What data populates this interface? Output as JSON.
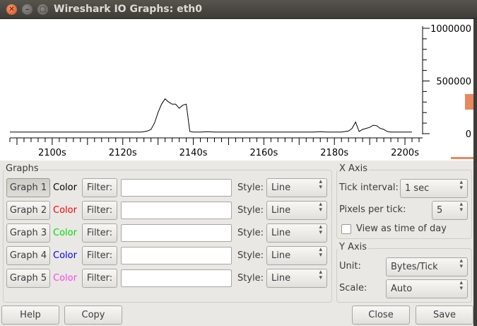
{
  "window": {
    "title": "Wireshark IO Graphs: eth0"
  },
  "chart_data": {
    "type": "line",
    "x": [
      2088,
      2090,
      2092,
      2094,
      2096,
      2098,
      2100,
      2102,
      2104,
      2106,
      2108,
      2110,
      2112,
      2114,
      2116,
      2118,
      2119,
      2120,
      2121,
      2122,
      2123,
      2124,
      2125,
      2126,
      2127,
      2128,
      2129,
      2130,
      2131,
      2132,
      2133,
      2134,
      2135,
      2136,
      2137,
      2138,
      2139,
      2140,
      2142,
      2144,
      2146,
      2148,
      2150,
      2152,
      2154,
      2156,
      2158,
      2160,
      2162,
      2164,
      2166,
      2168,
      2170,
      2172,
      2174,
      2176,
      2178,
      2180,
      2182,
      2183,
      2184,
      2185,
      2186,
      2187,
      2188,
      2189,
      2190,
      2191,
      2192,
      2193,
      2194,
      2195,
      2196,
      2198,
      2200,
      2202
    ],
    "values": [
      15000,
      15000,
      15000,
      15000,
      15000,
      15000,
      15000,
      15000,
      15000,
      15000,
      15000,
      15000,
      15000,
      15000,
      15000,
      15000,
      15000,
      15000,
      15000,
      15000,
      15000,
      15000,
      15000,
      18000,
      25000,
      40000,
      100000,
      200000,
      280000,
      330000,
      300000,
      280000,
      280000,
      240000,
      270000,
      280000,
      20000,
      15000,
      15000,
      18000,
      15000,
      15000,
      15000,
      15000,
      15000,
      15000,
      15000,
      15000,
      15000,
      15000,
      15000,
      15000,
      15000,
      15000,
      15000,
      18000,
      15000,
      15000,
      15000,
      20000,
      25000,
      50000,
      110000,
      20000,
      40000,
      50000,
      60000,
      80000,
      75000,
      50000,
      40000,
      20000,
      15000,
      15000,
      15000,
      15000
    ],
    "xticks": [
      "2100s",
      "2120s",
      "2140s",
      "2160s",
      "2180s",
      "2200s"
    ],
    "xtick_values": [
      2100,
      2120,
      2140,
      2160,
      2180,
      2200
    ],
    "yticks": [
      "1000000",
      "500000",
      "0"
    ],
    "ytick_values": [
      1000000,
      500000,
      0
    ],
    "xlim": [
      2088,
      2205
    ],
    "ylim": [
      0,
      1000000
    ],
    "grid": false
  },
  "graphs": {
    "group_label": "Graphs",
    "color_label": "Color",
    "filter_label": "Filter:",
    "style_label": "Style:",
    "rows": [
      {
        "button": "Graph 1",
        "color": "#000000",
        "filter": "",
        "style": "Line",
        "pressed": true
      },
      {
        "button": "Graph 2",
        "color": "#ff0000",
        "filter": "",
        "style": "Line",
        "pressed": false
      },
      {
        "button": "Graph 3",
        "color": "#00dd00",
        "filter": "",
        "style": "Line",
        "pressed": false
      },
      {
        "button": "Graph 4",
        "color": "#0000ff",
        "filter": "",
        "style": "Line",
        "pressed": false
      },
      {
        "button": "Graph 5",
        "color": "#ff44ee",
        "filter": "",
        "style": "Line",
        "pressed": false
      }
    ]
  },
  "x_axis": {
    "group_label": "X Axis",
    "tick_interval_label": "Tick interval:",
    "tick_interval_value": "1 sec",
    "pixels_per_tick_label": "Pixels per tick:",
    "pixels_per_tick_value": "5",
    "view_as_time_label": "View as time of day",
    "view_as_time_checked": false
  },
  "y_axis": {
    "group_label": "Y Axis",
    "unit_label": "Unit:",
    "unit_value": "Bytes/Tick",
    "scale_label": "Scale:",
    "scale_value": "Auto"
  },
  "buttons": {
    "help": "Help",
    "copy": "Copy",
    "close": "Close",
    "save": "Save"
  }
}
